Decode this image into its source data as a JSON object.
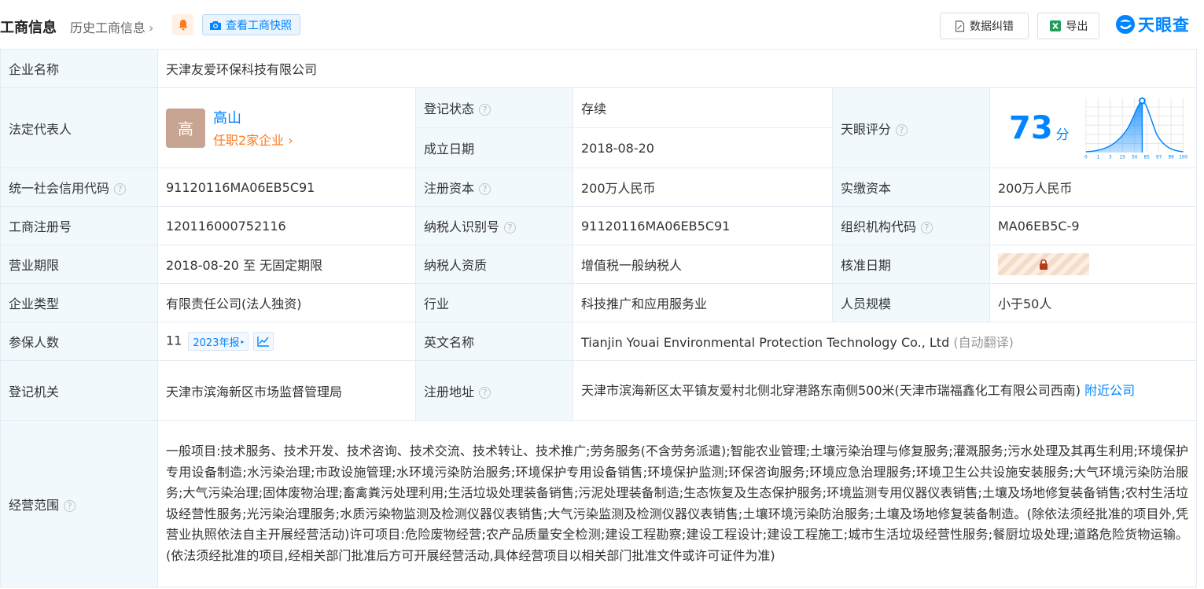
{
  "header": {
    "title": "工商信息",
    "history_link": "历史工商信息",
    "snapshot_button": "查看工商快照",
    "data_fix_button": "数据纠错",
    "export_button": "导出",
    "logo_text": "天眼查"
  },
  "labels": {
    "company_name": "企业名称",
    "legal_rep": "法定代表人",
    "reg_status": "登记状态",
    "founded": "成立日期",
    "tianyan_score": "天眼评分",
    "credit_code": "统一社会信用代码",
    "reg_capital": "注册资本",
    "paid_capital": "实缴资本",
    "reg_number": "工商注册号",
    "taxpayer_id": "纳税人识别号",
    "org_code": "组织机构代码",
    "term": "营业期限",
    "taxpayer_qual": "纳税人资质",
    "approval_date": "核准日期",
    "company_type": "企业类型",
    "industry": "行业",
    "staff_size": "人员规模",
    "insured": "参保人数",
    "english_name": "英文名称",
    "reg_authority": "登记机关",
    "reg_address": "注册地址",
    "business_scope": "经营范围"
  },
  "values": {
    "company_name": "天津友爱环保科技有限公司",
    "legal_rep_avatar": "高",
    "legal_rep_name": "高山",
    "legal_rep_jobs": "任职2家企业",
    "reg_status": "存续",
    "founded": "2018-08-20",
    "score": "73",
    "score_unit": "分",
    "score_ticks": [
      "0",
      "1",
      "3",
      "15",
      "50",
      "85",
      "97",
      "99",
      "100"
    ],
    "credit_code": "91120116MA06EB5C91",
    "reg_capital": "200万人民币",
    "paid_capital": "200万人民币",
    "reg_number": "120116000752116",
    "taxpayer_id": "91120116MA06EB5C91",
    "org_code": "MA06EB5C-9",
    "term": "2018-08-20 至 无固定期限",
    "taxpayer_qual": "增值税一般纳税人",
    "company_type": "有限责任公司(法人独资)",
    "industry": "科技推广和应用服务业",
    "staff_size": "小于50人",
    "insured": "11",
    "annual_report": "2023年报",
    "english_name": "Tianjin Youai Environmental Protection Technology Co., Ltd",
    "english_note": "(自动翻译)",
    "reg_authority": "天津市滨海新区市场监督管理局",
    "reg_address": "天津市滨海新区太平镇友爱村北侧北穿港路东南侧500米(天津市瑞福鑫化工有限公司西南)",
    "nearby_link": "附近公司",
    "business_scope": "一般项目:技术服务、技术开发、技术咨询、技术交流、技术转让、技术推广;劳务服务(不含劳务派遣);智能农业管理;土壤污染治理与修复服务;灌溉服务;污水处理及其再生利用;环境保护专用设备制造;水污染治理;市政设施管理;水环境污染防治服务;环境保护专用设备销售;环境保护监测;环保咨询服务;环境应急治理服务;环境卫生公共设施安装服务;大气环境污染防治服务;大气污染治理;固体废物治理;畜禽粪污处理利用;生活垃圾处理装备销售;污泥处理装备制造;生态恢复及生态保护服务;环境监测专用仪器仪表销售;土壤及场地修复装备销售;农村生活垃圾经营性服务;光污染治理服务;水质污染物监测及检测仪器仪表销售;大气污染监测及检测仪器仪表销售;土壤环境污染防治服务;土壤及场地修复装备制造。(除依法须经批准的项目外,凭营业执照依法自主开展经营活动)许可项目:危险废物经营;农产品质量安全检测;建设工程勘察;建设工程设计;建设工程施工;城市生活垃圾经营性服务;餐厨垃圾处理;道路危险货物运输。(依法须经批准的项目,经相关部门批准后方可开展经营活动,具体经营项目以相关部门批准文件或许可证件为准)"
  },
  "colors": {
    "accent": "#0084ff",
    "status_green": "#07a35b",
    "orange": "#ff7a1a",
    "label_bg": "#f2f9fd"
  }
}
